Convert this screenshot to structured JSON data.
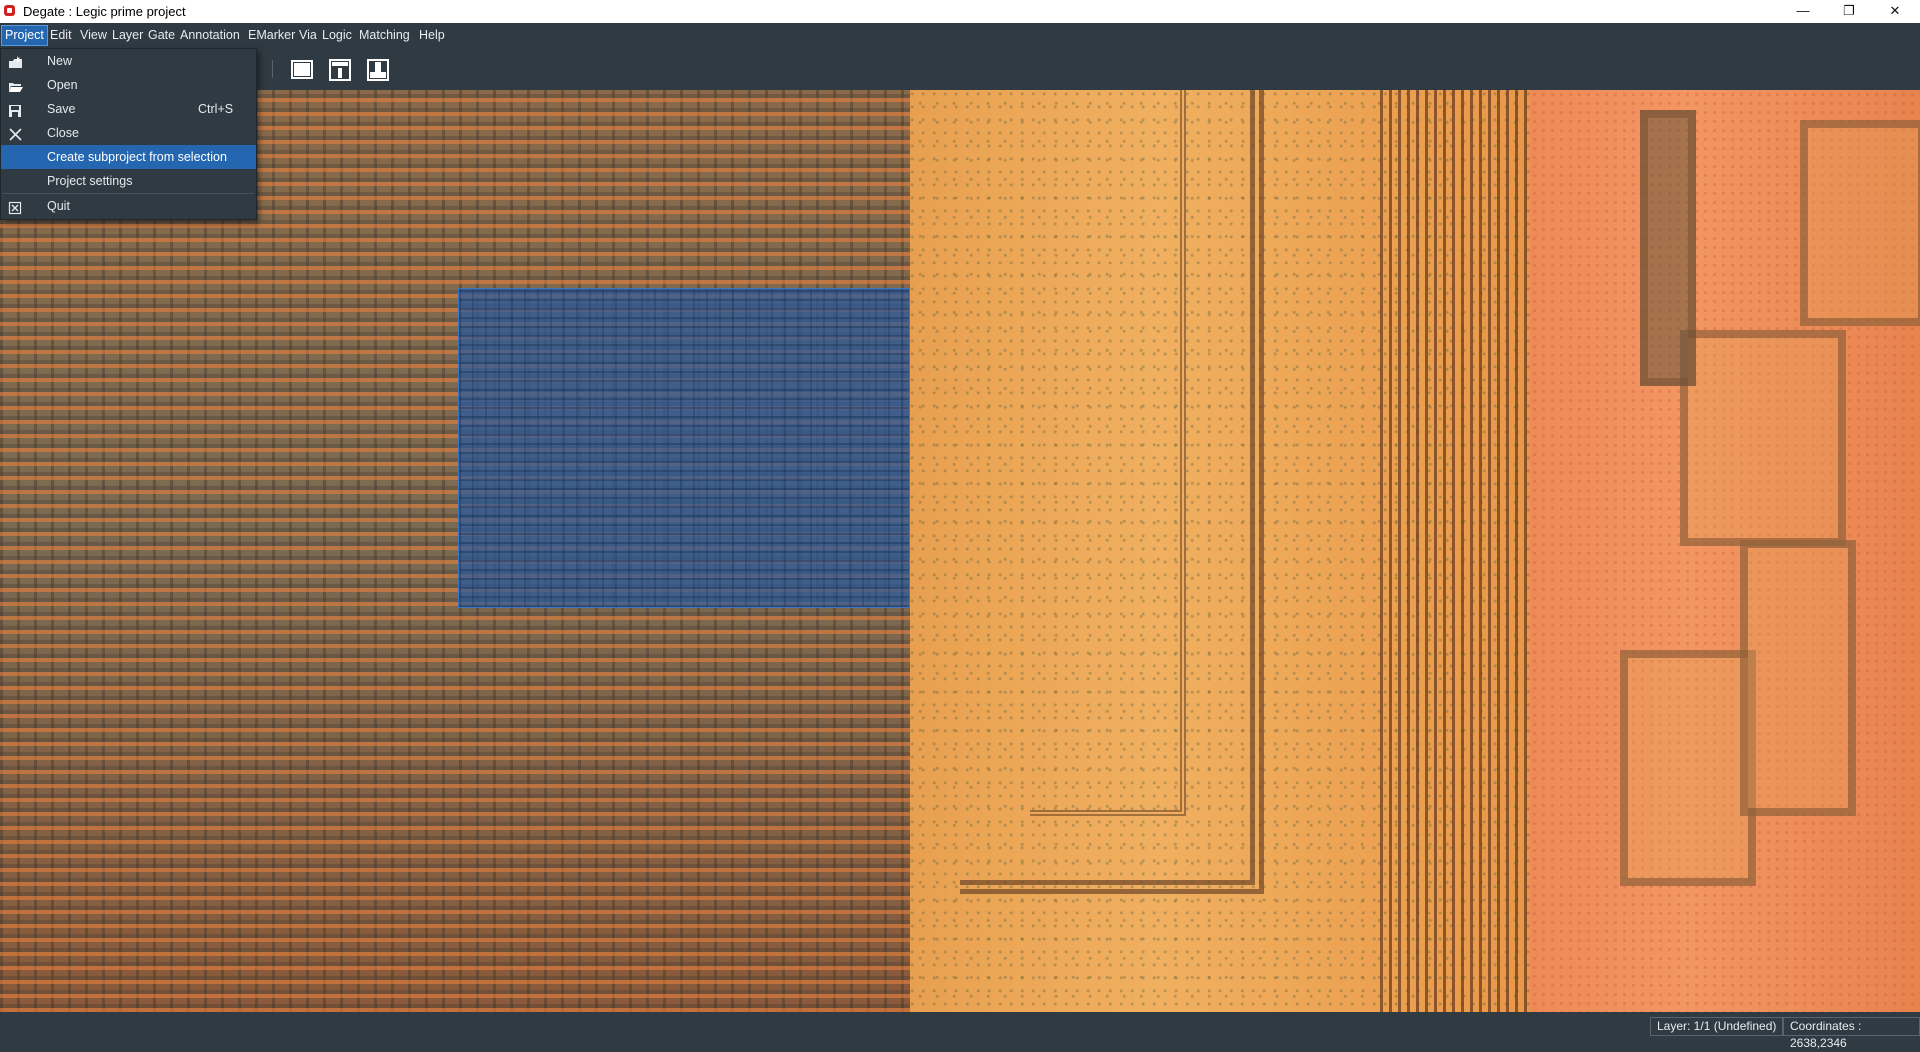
{
  "window": {
    "title": "Degate : Legic prime project",
    "minimize_glyph": "—",
    "maximize_glyph": "❐",
    "close_glyph": "✕"
  },
  "menubar": {
    "items": [
      "Project",
      "Edit",
      "View",
      "Layer",
      "Gate",
      "Annotation",
      "EMarker",
      "Via",
      "Logic",
      "Matching",
      "Help"
    ],
    "active": "Project"
  },
  "project_menu": {
    "items": [
      {
        "label": "New",
        "shortcut": "",
        "icon": "new-project-icon"
      },
      {
        "label": "Open",
        "shortcut": "",
        "icon": "folder-open-icon"
      },
      {
        "label": "Save",
        "shortcut": "Ctrl+S",
        "icon": "save-icon"
      },
      {
        "label": "Close",
        "shortcut": "",
        "icon": "close-x-icon"
      },
      {
        "label": "Create subproject from selection",
        "shortcut": "",
        "icon": ""
      },
      {
        "label": "Project settings",
        "shortcut": "",
        "icon": ""
      },
      {
        "label": "Quit",
        "shortcut": "",
        "icon": "quit-icon"
      }
    ],
    "highlighted": "Create subproject from selection"
  },
  "toolbar": {
    "buttons": [
      "fullscreen-view-icon",
      "area-top-icon",
      "area-bottom-icon"
    ]
  },
  "statusbar": {
    "layer": "Layer: 1/1 (Undefined)",
    "coordinates": "Coordinates : 2638,2346"
  },
  "colors": {
    "chrome": "#2f3a42",
    "highlight": "#2467b0",
    "selection_overlay": "#285aa0"
  }
}
